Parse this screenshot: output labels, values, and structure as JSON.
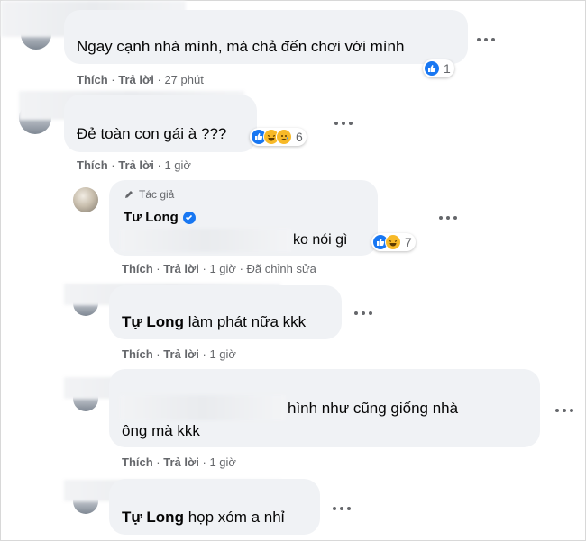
{
  "actions": {
    "like": "Thích",
    "reply": "Trả lời",
    "sep": "·"
  },
  "comments": [
    {
      "text": "Ngay cạnh nhà mình, mà chả đến chơi với mình",
      "time": "27 phút",
      "reactions": [
        "like-icon"
      ],
      "reaction_count": "1"
    },
    {
      "text": "Đẻ toàn con gái à ???",
      "time": "1 giờ",
      "reactions": [
        "like-icon",
        "haha-icon",
        "sad-icon"
      ],
      "reaction_count": "6"
    },
    {
      "author_badge": "Tác giả",
      "author_name": "Tư Long",
      "text": "ko nói gì",
      "time": "1 giờ",
      "edited": "Đã chỉnh sửa",
      "reactions": [
        "like-icon",
        "haha-icon"
      ],
      "reaction_count": "7"
    },
    {
      "tag": "Tự Long",
      "text": "làm phát nữa kkk",
      "time": "1 giờ"
    },
    {
      "line1": "hình như cũng giống nhà",
      "line2": "ông mà kkk",
      "time": "1 giờ"
    },
    {
      "tag": "Tự Long",
      "text": "họp xóm a nhỉ"
    }
  ],
  "colors": {
    "bubble": "#f0f2f5",
    "meta": "#65676b",
    "like_blue": "#1877f2",
    "haha_yellow": "#f7b928"
  }
}
